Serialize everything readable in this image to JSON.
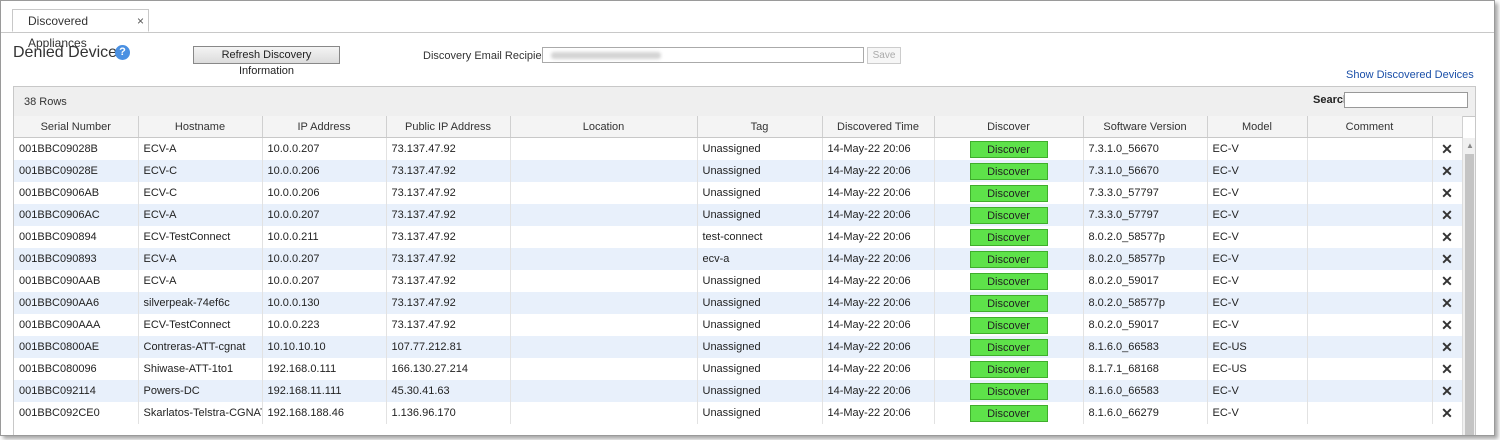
{
  "tabs": [
    {
      "label": "Discovered Appliances",
      "close": "×"
    }
  ],
  "page_title": "Denied Devices",
  "help_glyph": "?",
  "toolbar": {
    "refresh_label": "Refresh Discovery Information",
    "email_label": "Discovery Email Recipients",
    "save_label": "Save",
    "show_link": "Show Discovered Devices"
  },
  "grid": {
    "row_count": "38 Rows",
    "search_label": "Search",
    "columns": [
      "Serial Number",
      "Hostname",
      "IP Address",
      "Public IP Address",
      "Location",
      "Tag",
      "Discovered Time",
      "Discover",
      "Software Version",
      "Model",
      "Comment",
      ""
    ],
    "discover_label": "Discover",
    "delete_glyph": "✕",
    "rows": [
      [
        "001BBC09028B",
        "ECV-A",
        "10.0.0.207",
        "73.137.47.92",
        "",
        "Unassigned",
        "14-May-22 20:06",
        "7.3.1.0_56670",
        "EC-V",
        ""
      ],
      [
        "001BBC09028E",
        "ECV-C",
        "10.0.0.206",
        "73.137.47.92",
        "",
        "Unassigned",
        "14-May-22 20:06",
        "7.3.1.0_56670",
        "EC-V",
        ""
      ],
      [
        "001BBC0906AB",
        "ECV-C",
        "10.0.0.206",
        "73.137.47.92",
        "",
        "Unassigned",
        "14-May-22 20:06",
        "7.3.3.0_57797",
        "EC-V",
        ""
      ],
      [
        "001BBC0906AC",
        "ECV-A",
        "10.0.0.207",
        "73.137.47.92",
        "",
        "Unassigned",
        "14-May-22 20:06",
        "7.3.3.0_57797",
        "EC-V",
        ""
      ],
      [
        "001BBC090894",
        "ECV-TestConnect",
        "10.0.0.211",
        "73.137.47.92",
        "",
        "test-connect",
        "14-May-22 20:06",
        "8.0.2.0_58577p",
        "EC-V",
        ""
      ],
      [
        "001BBC090893",
        "ECV-A",
        "10.0.0.207",
        "73.137.47.92",
        "",
        "ecv-a",
        "14-May-22 20:06",
        "8.0.2.0_58577p",
        "EC-V",
        ""
      ],
      [
        "001BBC090AAB",
        "ECV-A",
        "10.0.0.207",
        "73.137.47.92",
        "",
        "Unassigned",
        "14-May-22 20:06",
        "8.0.2.0_59017",
        "EC-V",
        ""
      ],
      [
        "001BBC090AA6",
        "silverpeak-74ef6c",
        "10.0.0.130",
        "73.137.47.92",
        "",
        "Unassigned",
        "14-May-22 20:06",
        "8.0.2.0_58577p",
        "EC-V",
        ""
      ],
      [
        "001BBC090AAA",
        "ECV-TestConnect",
        "10.0.0.223",
        "73.137.47.92",
        "",
        "Unassigned",
        "14-May-22 20:06",
        "8.0.2.0_59017",
        "EC-V",
        ""
      ],
      [
        "001BBC0800AE",
        "Contreras-ATT-cgnat",
        "10.10.10.10",
        "107.77.212.81",
        "",
        "Unassigned",
        "14-May-22 20:06",
        "8.1.6.0_66583",
        "EC-US",
        ""
      ],
      [
        "001BBC080096",
        "Shiwase-ATT-1to1",
        "192.168.0.111",
        "166.130.27.214",
        "",
        "Unassigned",
        "14-May-22 20:06",
        "8.1.7.1_68168",
        "EC-US",
        ""
      ],
      [
        "001BBC092114",
        "Powers-DC",
        "192.168.11.111",
        "45.30.41.63",
        "",
        "Unassigned",
        "14-May-22 20:06",
        "8.1.6.0_66583",
        "EC-V",
        ""
      ],
      [
        "001BBC092CE0",
        "Skarlatos-Telstra-CGNAT",
        "192.168.188.46",
        "1.136.96.170",
        "",
        "Unassigned",
        "14-May-22 20:06",
        "8.1.6.0_66279",
        "EC-V",
        ""
      ]
    ]
  }
}
